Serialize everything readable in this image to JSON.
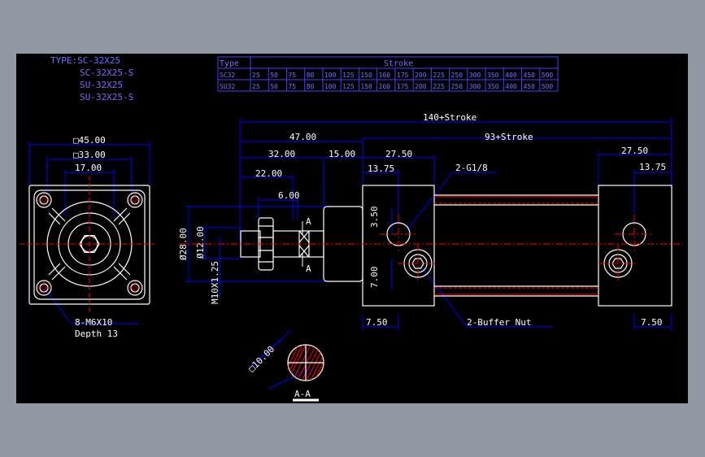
{
  "header": {
    "type_lines": [
      "TYPE:SC-32X25",
      "SC-32X25-S",
      "SU-32X25",
      "SU-32X25-S"
    ]
  },
  "stroke_table": {
    "col_type": "Type",
    "col_stroke": "Stroke",
    "rows": [
      {
        "type": "SC32",
        "values": [
          "25",
          "50",
          "75",
          "80",
          "100",
          "125",
          "150",
          "160",
          "175",
          "200",
          "225",
          "250",
          "300",
          "350",
          "400",
          "450",
          "500"
        ]
      },
      {
        "type": "SU32",
        "values": [
          "25",
          "50",
          "75",
          "80",
          "100",
          "125",
          "150",
          "160",
          "175",
          "200",
          "225",
          "250",
          "300",
          "350",
          "400",
          "450",
          "500"
        ]
      }
    ]
  },
  "front_view": {
    "dims": {
      "outer": "□45.00",
      "inner": "□33.00",
      "bore": "17.00"
    },
    "note_thread": "8-M6X10",
    "note_depth": "Depth 13"
  },
  "side_view": {
    "dims": {
      "overall": "140+Stroke",
      "body": "93+Stroke",
      "rod_total": "47.00",
      "rod_a": "32.00",
      "rod_b": "22.00",
      "rod_c": "6.00",
      "neck": "15.00",
      "head_left": "27.50",
      "head_left_port": "13.75",
      "head_right": "27.50",
      "head_right_port": "13.75",
      "dia_28": "Ø28.00",
      "dia_12": "Ø12.00",
      "thread": "M10X1.25",
      "port_off": "3.50",
      "buffer_off": "7.00",
      "bottom_left": "7.50",
      "bottom_right": "7.50"
    },
    "port_label": "2-G1/8",
    "buffer_label": "2-Buffer  Nut",
    "section_marker": "A"
  },
  "section_view": {
    "dim": "□10.00",
    "label": "A-A"
  },
  "colors": {
    "background": "#000000",
    "outline": "#ffffff",
    "dimension": "#0000ff",
    "centerline": "#ff0000",
    "text": "#ffffff",
    "type_text": "#7b6cff"
  }
}
